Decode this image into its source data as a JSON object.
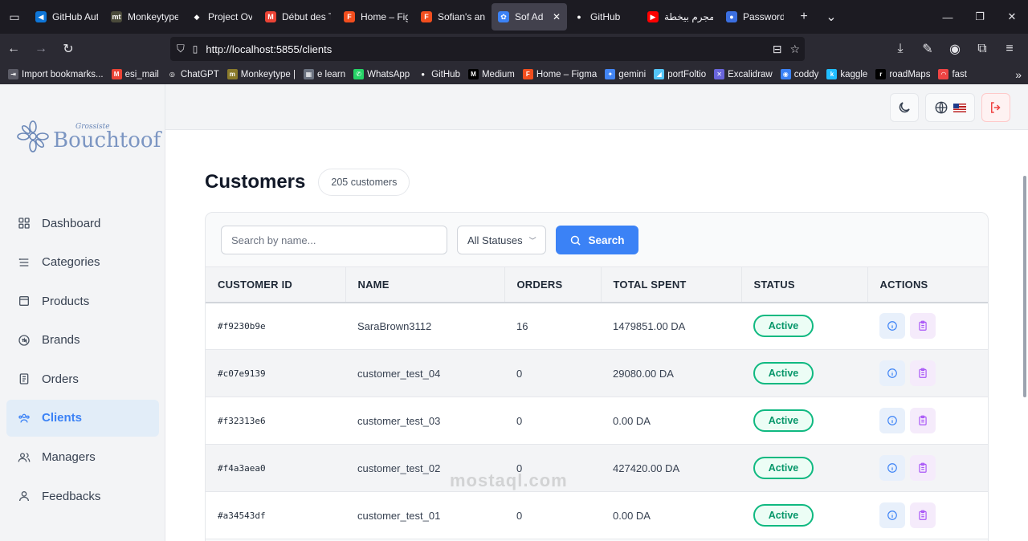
{
  "browser": {
    "tabs": [
      {
        "label": "GitHub Auth",
        "fav_color": "#0e76d8",
        "fav_char": "◀"
      },
      {
        "label": "Monkeytype",
        "fav_color": "#4a4a3a",
        "fav_char": "mt"
      },
      {
        "label": "Project Over",
        "fav_color": "#1c1b22",
        "fav_char": "◆"
      },
      {
        "label": "Début des T",
        "fav_color": "#ea4335",
        "fav_char": "M"
      },
      {
        "label": "Home – Figm",
        "fav_color": "#f24e1e",
        "fav_char": "F"
      },
      {
        "label": "Sofian's and",
        "fav_color": "#f24e1e",
        "fav_char": "F"
      },
      {
        "label": "Sof Admin",
        "fav_color": "#3b82f6",
        "fav_char": "✿"
      },
      {
        "label": "GitHub",
        "fav_color": "#1c1b22",
        "fav_char": "●"
      },
      {
        "label": "مجرم بيخطة",
        "fav_color": "#ff0000",
        "fav_char": "▶"
      },
      {
        "label": "Passwords",
        "fav_color": "#3b6fe0",
        "fav_char": "●"
      }
    ],
    "url": "http://localhost:5855/clients",
    "bookmarks": [
      {
        "label": "Import bookmarks...",
        "color": "#5b5b66",
        "char": "⇥"
      },
      {
        "label": "esi_mail",
        "color": "#ea4335",
        "char": "M"
      },
      {
        "label": "ChatGPT",
        "color": "#2b2a33",
        "char": "◎"
      },
      {
        "label": "Monkeytype |",
        "color": "#8a7a2a",
        "char": "m"
      },
      {
        "label": "e learn",
        "color": "#6b7280",
        "char": "▦"
      },
      {
        "label": "WhatsApp",
        "color": "#25d366",
        "char": "✆"
      },
      {
        "label": "GitHub",
        "color": "#2b2a33",
        "char": "●"
      },
      {
        "label": "Medium",
        "color": "#000000",
        "char": "M"
      },
      {
        "label": "Home – Figma",
        "color": "#f24e1e",
        "char": "F"
      },
      {
        "label": "gemini",
        "color": "#4285f4",
        "char": "✦"
      },
      {
        "label": "portFoltio",
        "color": "#54c5f8",
        "char": "◢"
      },
      {
        "label": "Excalidraw",
        "color": "#6965db",
        "char": "✕"
      },
      {
        "label": "coddy",
        "color": "#3b82f6",
        "char": "◉"
      },
      {
        "label": "kaggle",
        "color": "#20beff",
        "char": "k"
      },
      {
        "label": "roadMaps",
        "color": "#000000",
        "char": "r"
      },
      {
        "label": "fast",
        "color": "#ef4444",
        "char": "◠"
      }
    ]
  },
  "sidebar": {
    "logo_small": "Grossiste",
    "logo_big": "Bouchtoof",
    "items": [
      {
        "label": "Dashboard",
        "icon": "dashboard-icon"
      },
      {
        "label": "Categories",
        "icon": "categories-icon"
      },
      {
        "label": "Products",
        "icon": "products-icon"
      },
      {
        "label": "Brands",
        "icon": "brands-icon"
      },
      {
        "label": "Orders",
        "icon": "orders-icon"
      },
      {
        "label": "Clients",
        "icon": "clients-icon"
      },
      {
        "label": "Managers",
        "icon": "managers-icon"
      },
      {
        "label": "Feedbacks",
        "icon": "feedbacks-icon"
      }
    ],
    "active": "Clients"
  },
  "header": {
    "theme_icon": "moon-icon",
    "language_icon": "globe-icon",
    "logout_icon": "logout-icon",
    "accent": "#3b82f6",
    "danger": "#ef4444"
  },
  "page": {
    "title": "Customers",
    "count": "205 customers"
  },
  "filters": {
    "search_placeholder": "Search by name...",
    "status_value": "All Statuses",
    "search_button": "Search"
  },
  "table": {
    "columns": [
      "CUSTOMER ID",
      "NAME",
      "ORDERS",
      "TOTAL SPENT",
      "STATUS",
      "ACTIONS"
    ],
    "rows": [
      {
        "id": "#f9230b9e",
        "name": "SaraBrown3112",
        "orders": "16",
        "total": "1479851.00 DA",
        "status": "Active"
      },
      {
        "id": "#c07e9139",
        "name": "customer_test_04",
        "orders": "0",
        "total": "29080.00 DA",
        "status": "Active"
      },
      {
        "id": "#f32313e6",
        "name": "customer_test_03",
        "orders": "0",
        "total": "0.00 DA",
        "status": "Active"
      },
      {
        "id": "#f4a3aea0",
        "name": "customer_test_02",
        "orders": "0",
        "total": "427420.00 DA",
        "status": "Active"
      },
      {
        "id": "#a34543df",
        "name": "customer_test_01",
        "orders": "0",
        "total": "0.00 DA",
        "status": "Active"
      }
    ]
  },
  "watermark": "mostaql.com"
}
